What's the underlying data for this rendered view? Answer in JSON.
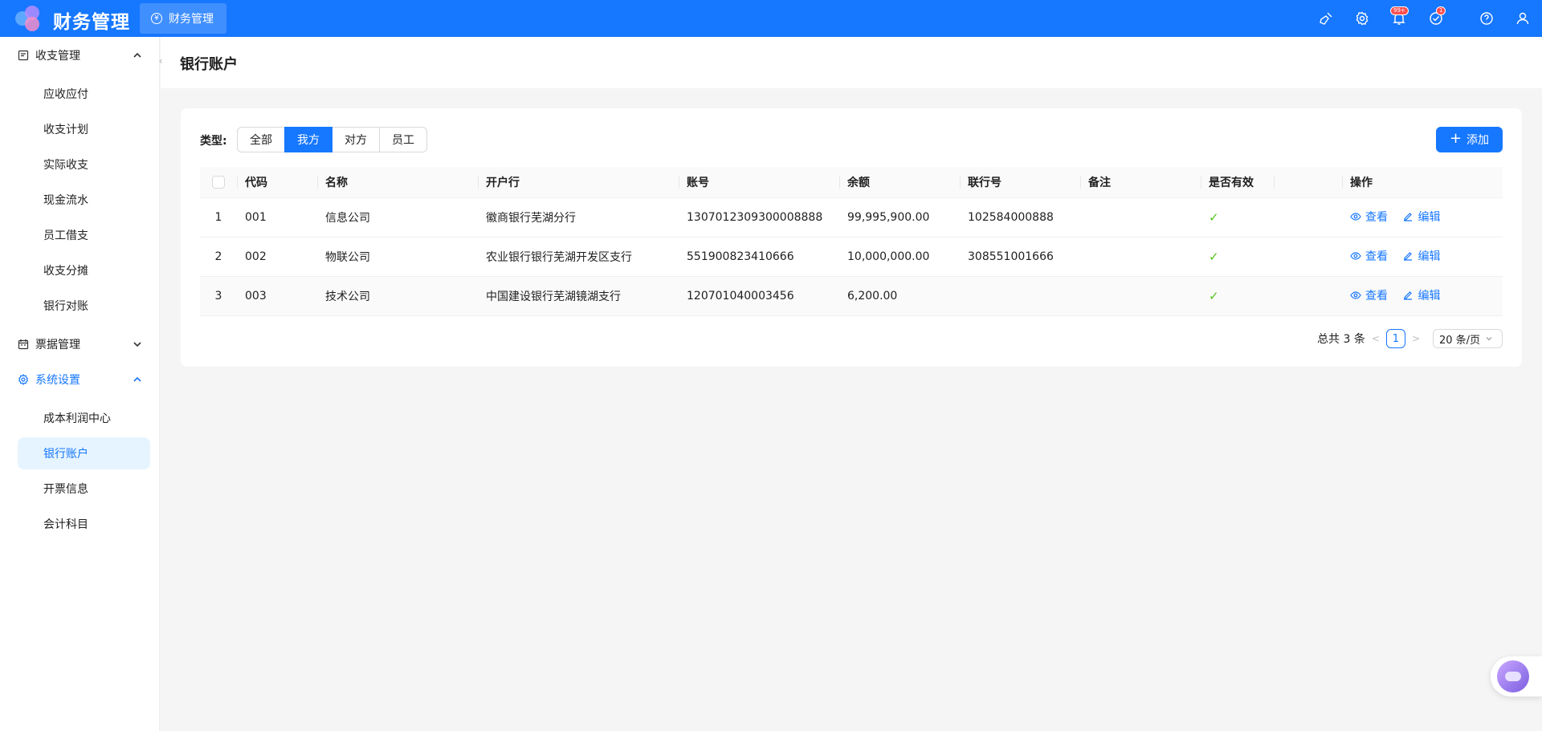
{
  "header": {
    "app_title": "财务管理",
    "module_tab": "财务管理",
    "notification_badge": "99+",
    "task_badge": "1"
  },
  "sidebar": {
    "groups": [
      {
        "label": "收支管理",
        "expanded": true,
        "items": [
          "应收应付",
          "收支计划",
          "实际收支",
          "现金流水",
          "员工借支",
          "收支分摊",
          "银行对账"
        ]
      },
      {
        "label": "票据管理",
        "expanded": false
      },
      {
        "label": "系统设置",
        "expanded": true,
        "active": true,
        "items": [
          "成本利润中心",
          "银行账户",
          "开票信息",
          "会计科目"
        ]
      }
    ],
    "selected_item": "银行账户"
  },
  "page": {
    "title": "银行账户",
    "type_label": "类型:",
    "type_options": [
      "全部",
      "我方",
      "对方",
      "员工"
    ],
    "type_selected": "我方",
    "add_button": "添加"
  },
  "table": {
    "columns": [
      "代码",
      "名称",
      "开户行",
      "账号",
      "余额",
      "联行号",
      "备注",
      "是否有效",
      "",
      "操作"
    ],
    "rows": [
      {
        "index": "1",
        "code": "001",
        "name": "信息公司",
        "bank": "徽商银行芜湖分行",
        "account": "1307012309300008888",
        "balance": "99,995,900.00",
        "bank_code": "102584000888",
        "remark": "",
        "valid": "✓"
      },
      {
        "index": "2",
        "code": "002",
        "name": "物联公司",
        "bank": "农业银行银行芜湖开发区支行",
        "account": "551900823410666",
        "balance": "10,000,000.00",
        "bank_code": "308551001666",
        "remark": "",
        "valid": "✓"
      },
      {
        "index": "3",
        "code": "003",
        "name": "技术公司",
        "bank": "中国建设银行芜湖镜湖支行",
        "account": "120701040003456",
        "balance": "6,200.00",
        "bank_code": "",
        "remark": "",
        "valid": "✓"
      }
    ],
    "actions": {
      "view": "查看",
      "edit": "编辑"
    }
  },
  "pagination": {
    "total": "总共 3 条",
    "current": "1",
    "page_size": "20 条/页"
  },
  "colors": {
    "primary": "#1677ff",
    "success": "#52c41a",
    "badge": "#ff4d4f"
  }
}
